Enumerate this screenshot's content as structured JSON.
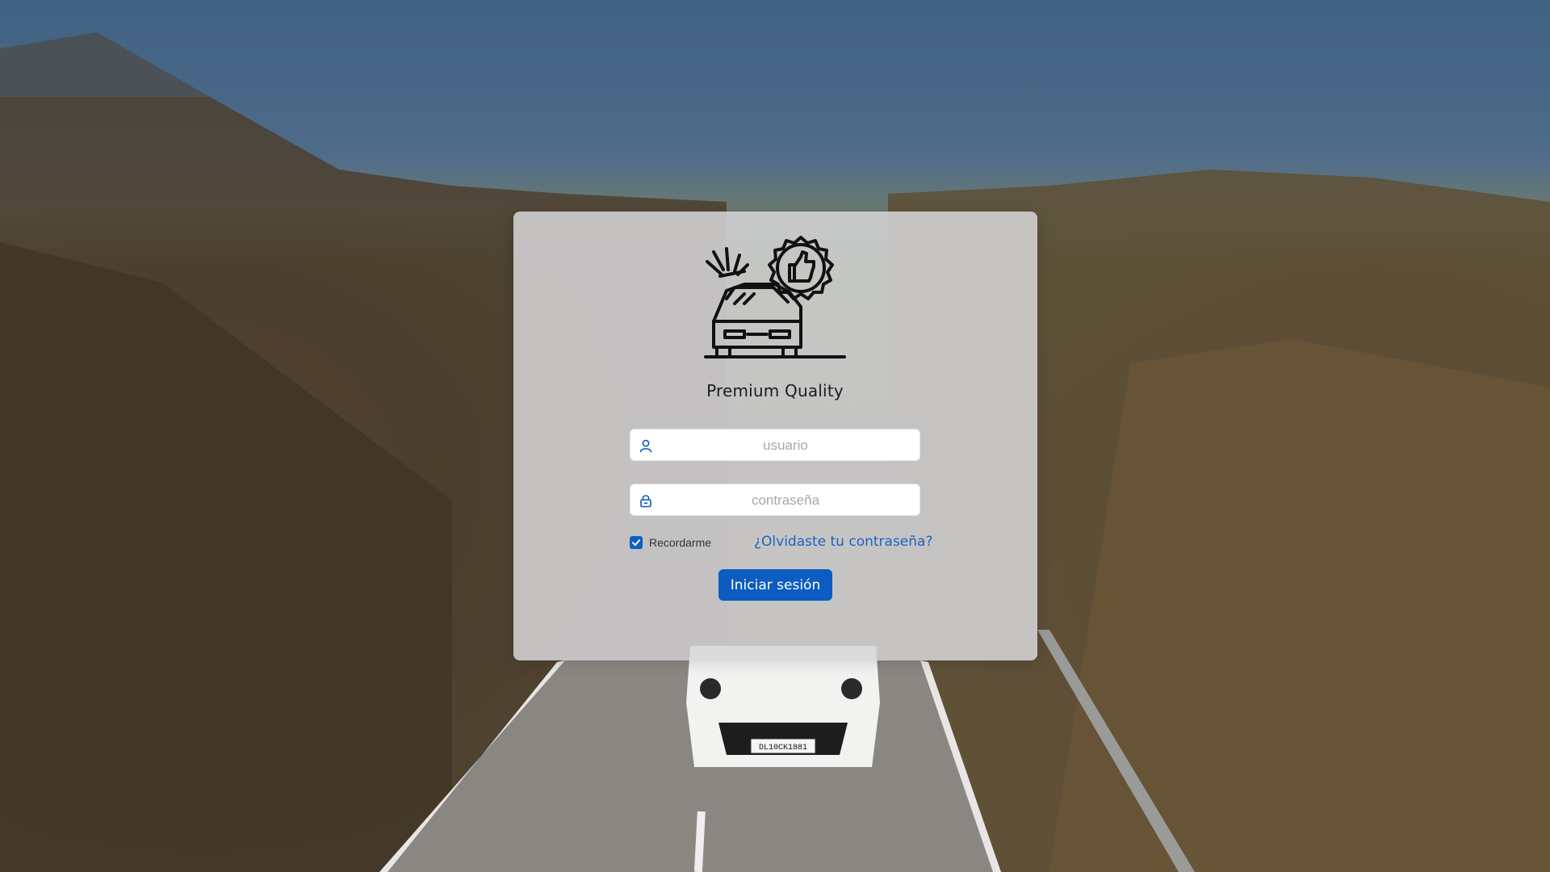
{
  "background": {
    "name": "car-road-photo",
    "plate_text": "DL10CK1881"
  },
  "login": {
    "brand": "Premium Quality",
    "username_placeholder": "usuario",
    "password_placeholder": "contraseña",
    "remember_label": "Recordarme",
    "remember_checked": true,
    "forgot_link": "¿Olvidaste tu contraseña?",
    "submit_label": "Iniciar sesión",
    "user_icon": "user-icon",
    "lock_icon": "lock-icon"
  },
  "colors": {
    "accent": "#0c5cc2",
    "link": "#1a63c7"
  }
}
